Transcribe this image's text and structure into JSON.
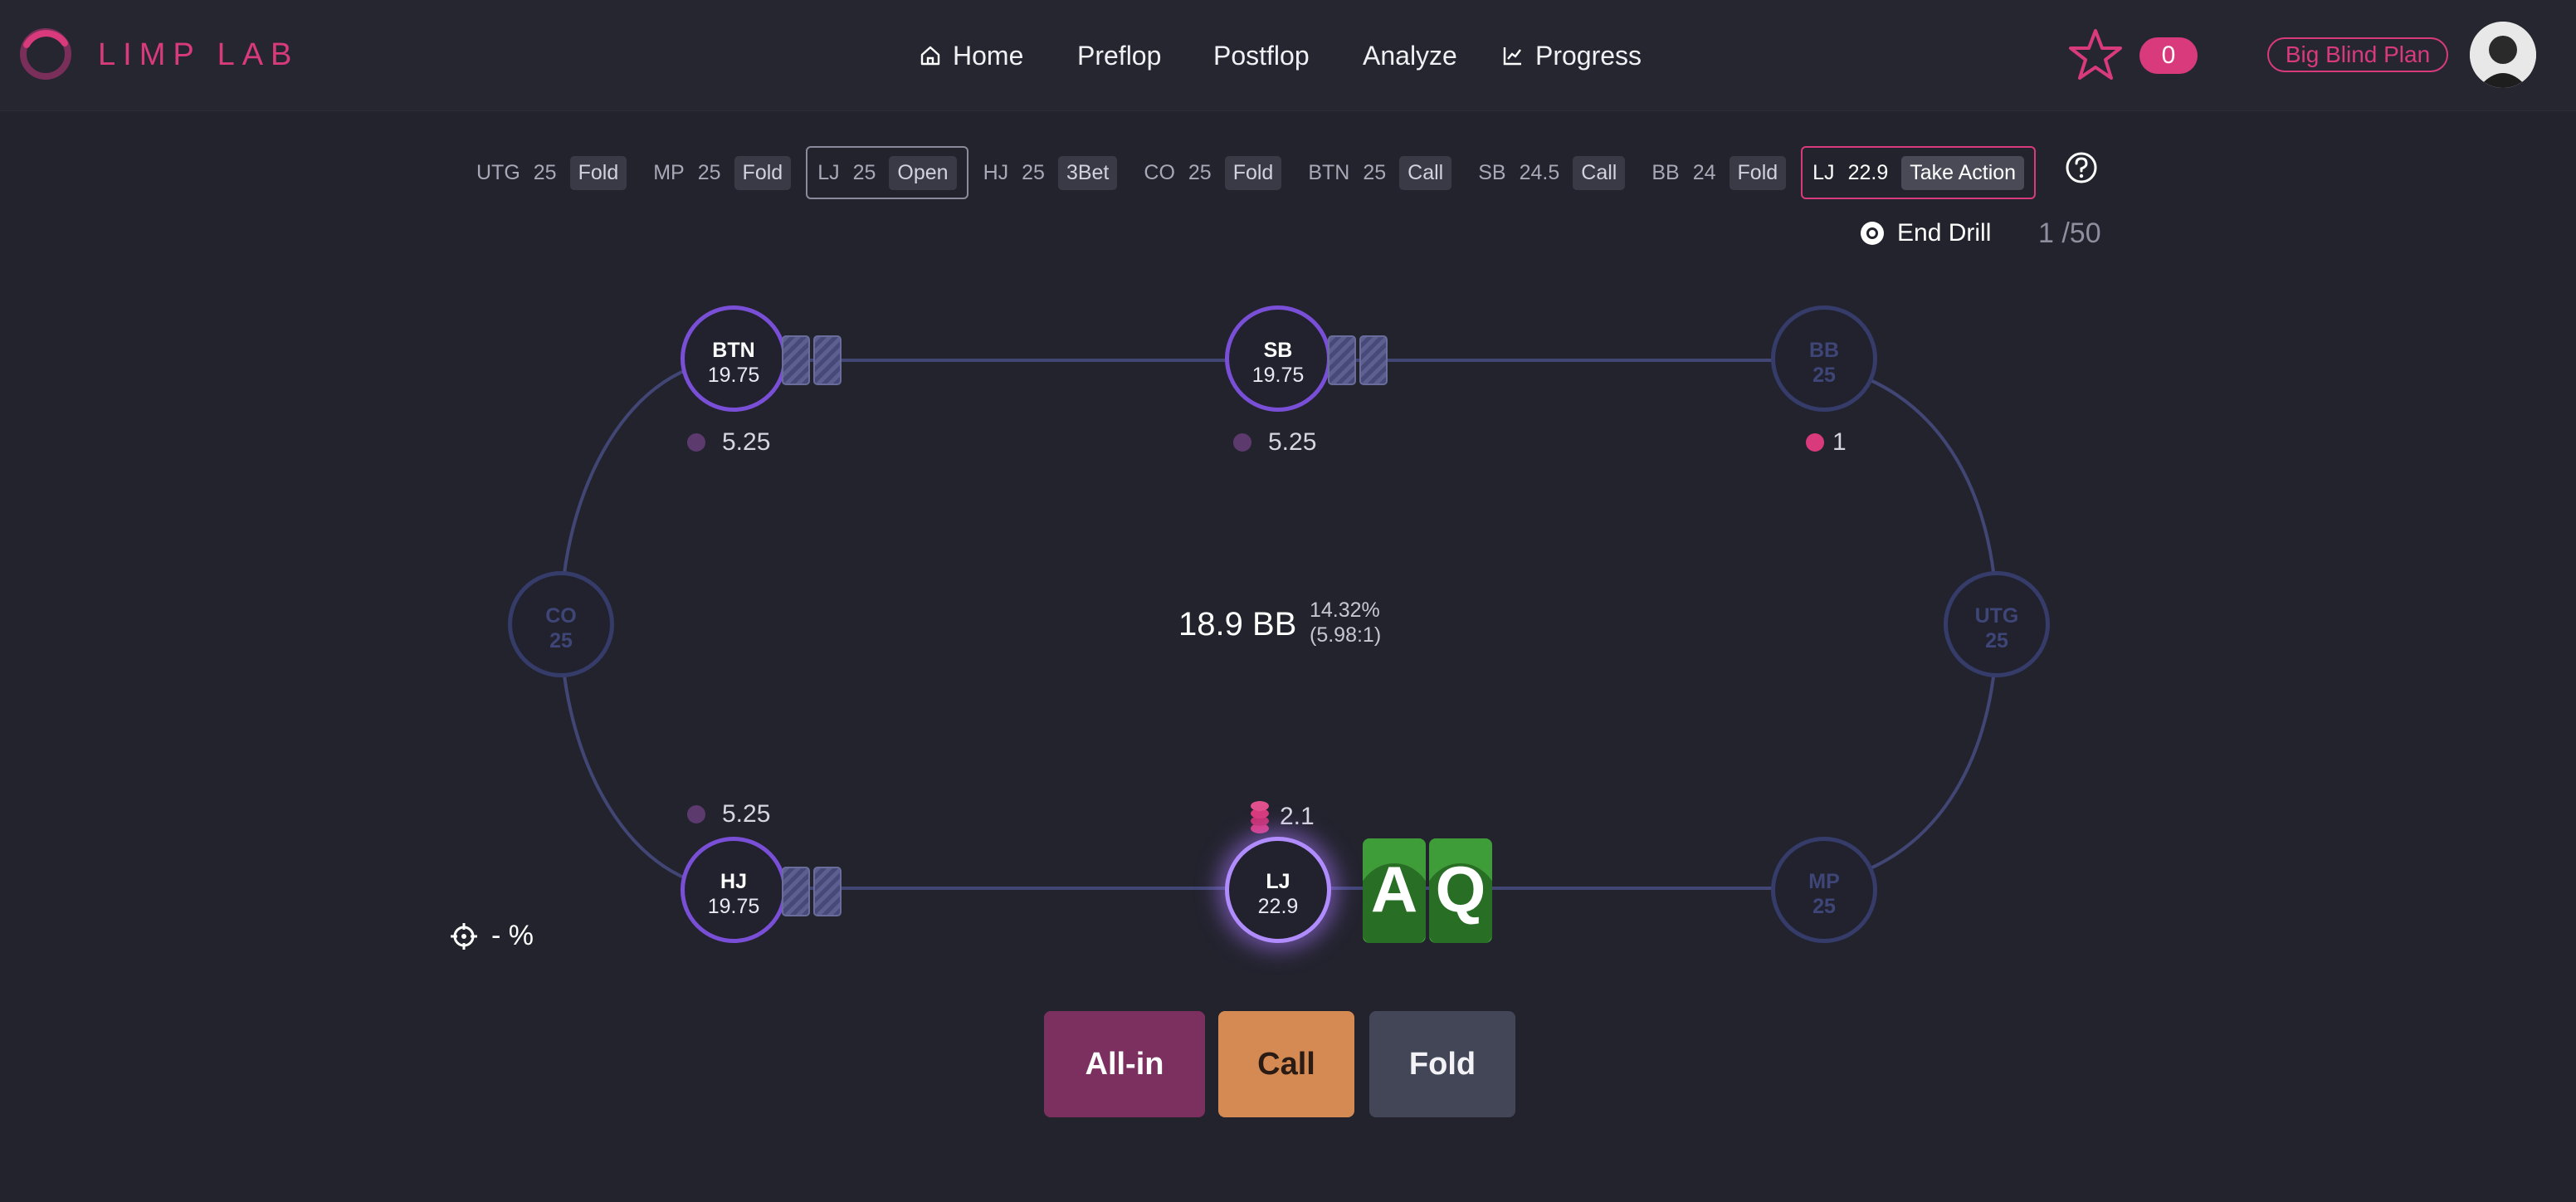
{
  "header": {
    "brand": "LIMP LAB",
    "nav": [
      {
        "label": "Home",
        "icon": "home-icon"
      },
      {
        "label": "Preflop"
      },
      {
        "label": "Postflop"
      },
      {
        "label": "Analyze"
      },
      {
        "label": "Progress",
        "icon": "chart-icon"
      }
    ],
    "score": "0",
    "plan": "Big Blind Plan"
  },
  "action_strip": [
    {
      "pos": "UTG",
      "stack": "25",
      "action": "Fold"
    },
    {
      "pos": "MP",
      "stack": "25",
      "action": "Fold"
    },
    {
      "pos": "LJ",
      "stack": "25",
      "action": "Open"
    },
    {
      "pos": "HJ",
      "stack": "25",
      "action": "3Bet"
    },
    {
      "pos": "CO",
      "stack": "25",
      "action": "Fold"
    },
    {
      "pos": "BTN",
      "stack": "25",
      "action": "Call"
    },
    {
      "pos": "SB",
      "stack": "24.5",
      "action": "Call"
    },
    {
      "pos": "BB",
      "stack": "24",
      "action": "Fold"
    },
    {
      "pos": "LJ",
      "stack": "22.9",
      "action": "Take Action"
    }
  ],
  "drill": {
    "end_label": "End Drill",
    "progress": "1 /50"
  },
  "table": {
    "seats": {
      "btn": {
        "pos": "BTN",
        "stack": "19.75",
        "bet": "5.25"
      },
      "sb": {
        "pos": "SB",
        "stack": "19.75",
        "bet": "5.25"
      },
      "bb": {
        "pos": "BB",
        "stack": "25",
        "bet": "1"
      },
      "co": {
        "pos": "CO",
        "stack": "25"
      },
      "utg": {
        "pos": "UTG",
        "stack": "25"
      },
      "hj": {
        "pos": "HJ",
        "stack": "19.75",
        "bet": "5.25"
      },
      "lj": {
        "pos": "LJ",
        "stack": "22.9",
        "bet": "2.1"
      },
      "mp": {
        "pos": "MP",
        "stack": "25"
      }
    },
    "pot": "18.9 BB",
    "pot_odds_pct": "14.32%",
    "pot_odds_ratio": "(5.98:1)",
    "hero_cards": [
      "A",
      "Q"
    ],
    "equity": "- %"
  },
  "actions": {
    "allin": "All-in",
    "call": "Call",
    "fold": "Fold"
  },
  "colors": {
    "brand": "#d83a7c",
    "active_seat": "#7a4fd8",
    "card": "#3f9d39"
  }
}
